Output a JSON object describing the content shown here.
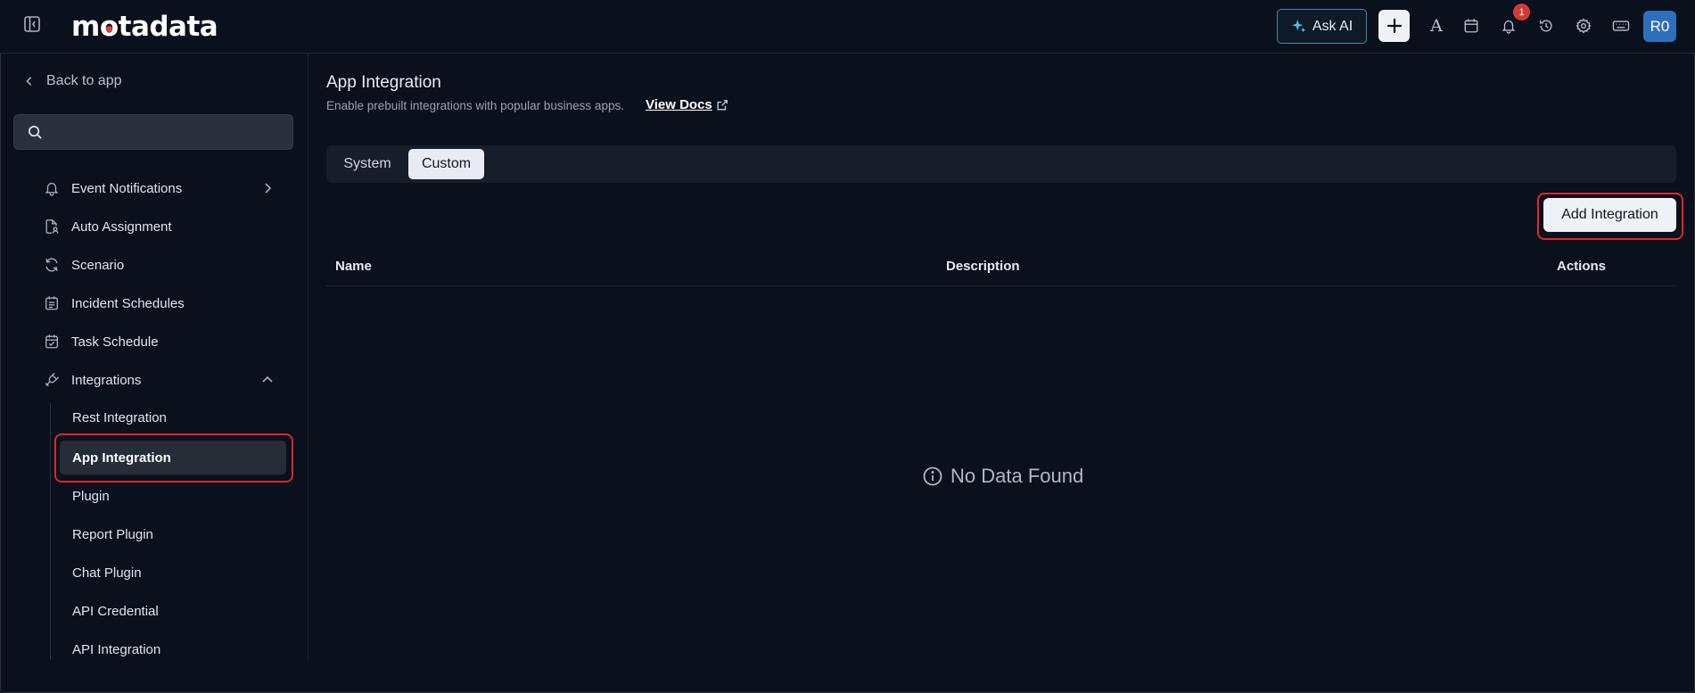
{
  "header": {
    "logo_text": "motadata",
    "ask_ai_label": "Ask AI",
    "notification_count": "1",
    "font_icon_label": "A",
    "avatar_initials": "R0",
    "brand_colors": {
      "accent": "#3e8aa3",
      "logo_dot": "#e1413b",
      "badge": "#d23b33",
      "avatar": "#2e6fbd"
    }
  },
  "sidebar": {
    "back_label": "Back to app",
    "search": {
      "value": "",
      "placeholder": ""
    },
    "items": [
      {
        "label": "Event Notifications",
        "icon": "bell-icon",
        "chevron": "right"
      },
      {
        "label": "Auto Assignment",
        "icon": "clipboard-user-icon"
      },
      {
        "label": "Scenario",
        "icon": "refresh-icon"
      },
      {
        "label": "Incident Schedules",
        "icon": "calendar-list-icon"
      },
      {
        "label": "Task Schedule",
        "icon": "calendar-check-icon"
      },
      {
        "label": "Integrations",
        "icon": "plug-icon",
        "chevron": "up",
        "expanded": true
      }
    ],
    "sub_items": [
      {
        "label": "Rest Integration"
      },
      {
        "label": "App Integration",
        "active": true
      },
      {
        "label": "Plugin"
      },
      {
        "label": "Report Plugin"
      },
      {
        "label": "Chat Plugin"
      },
      {
        "label": "API Credential"
      },
      {
        "label": "API Integration"
      }
    ]
  },
  "main": {
    "title": "App Integration",
    "subtitle": "Enable prebuilt integrations with popular business apps.",
    "view_docs_label": "View Docs",
    "tabs": [
      {
        "label": "System",
        "active": false
      },
      {
        "label": "Custom",
        "active": true
      }
    ],
    "add_button_label": "Add Integration",
    "table": {
      "columns": [
        "Name",
        "Description",
        "Actions"
      ],
      "rows": []
    },
    "empty_message": "No Data Found"
  }
}
